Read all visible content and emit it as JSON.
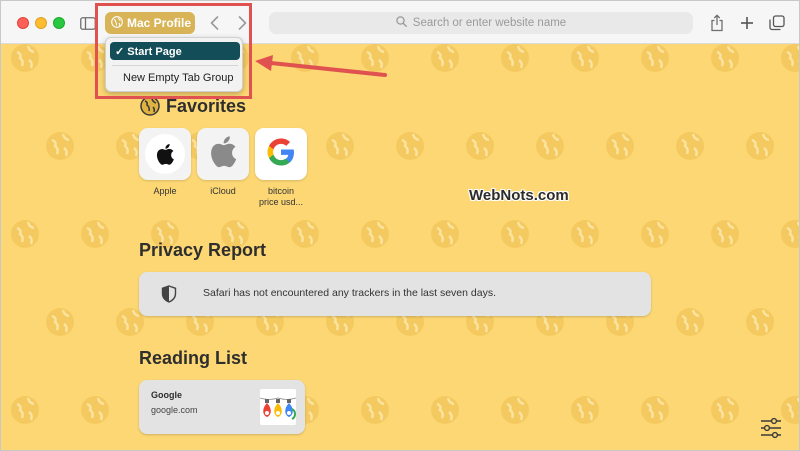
{
  "toolbar": {
    "profile_label": "Mac Profile",
    "address_placeholder": "Search or enter website name"
  },
  "dropdown": {
    "items": [
      {
        "label": "✓ Start Page",
        "selected": true
      },
      {
        "label": "New Empty Tab Group",
        "selected": false
      }
    ]
  },
  "favorites": {
    "title": "Favorites",
    "items": [
      {
        "label": "Apple",
        "icon": "apple-logo-icon"
      },
      {
        "label": "iCloud",
        "icon": "apple-logo-icon"
      },
      {
        "label_line1": "bitcoin",
        "label_line2": "price usd...",
        "icon": "google-logo-icon"
      }
    ]
  },
  "privacy": {
    "title": "Privacy Report",
    "message": "Safari has not encountered any trackers in the last seven days."
  },
  "reading_list": {
    "title": "Reading List",
    "items": [
      {
        "name": "Google",
        "url": "google.com"
      }
    ]
  },
  "watermark": "WebNots.com",
  "colors": {
    "page_background": "#fcd774",
    "profile_pill": "#d8b457",
    "menu_selected": "#124d58",
    "annotation_red": "#e0524f"
  }
}
